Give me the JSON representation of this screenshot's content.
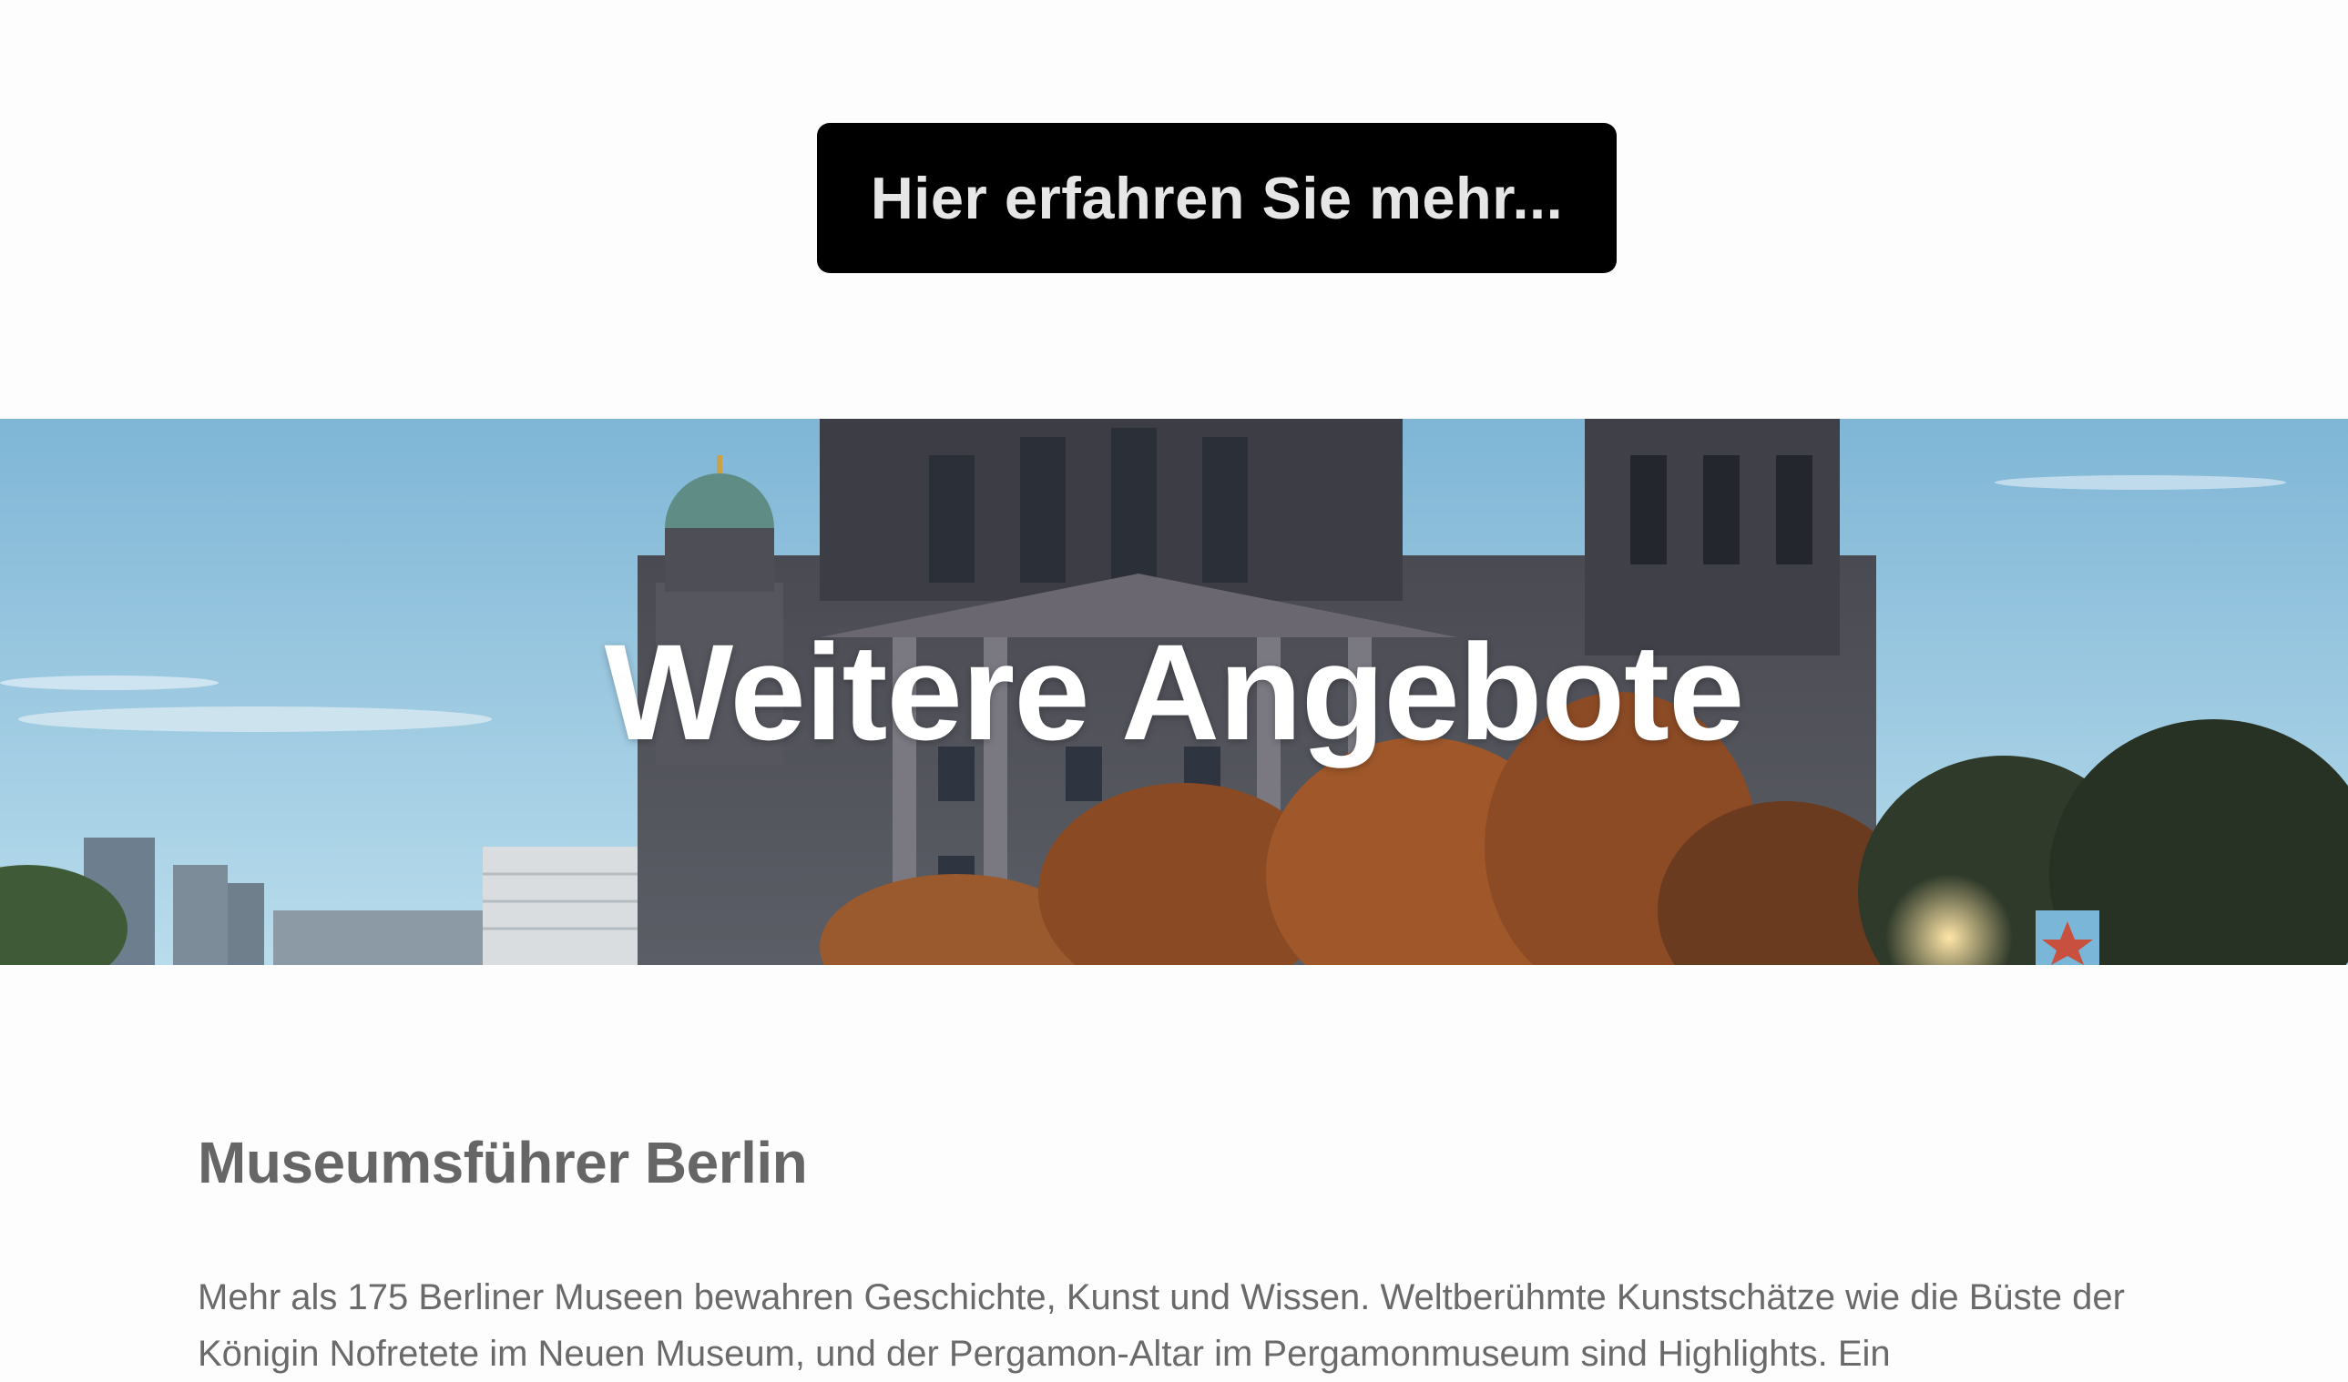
{
  "cta": {
    "label": "Hier erfahren Sie mehr..."
  },
  "hero": {
    "title": "Weitere Angebote",
    "image": "berlin-cathedral-autumn-photo"
  },
  "section": {
    "heading": "Museumsführer Berlin",
    "paragraph": "Mehr als 175 Berliner Museen bewahren Geschichte, Kunst und Wissen. Weltberühmte Kunstschätze wie die Büste der Königin Nofretete im Neuen Museum, und der Pergamon-Altar im Pergamonmuseum sind Highlights. Ein"
  },
  "colors": {
    "button_bg": "#000000",
    "button_text": "#e6e6e6",
    "heading": "#666666",
    "body_text": "#6a6a6a",
    "sky": "#9ccbe3"
  }
}
